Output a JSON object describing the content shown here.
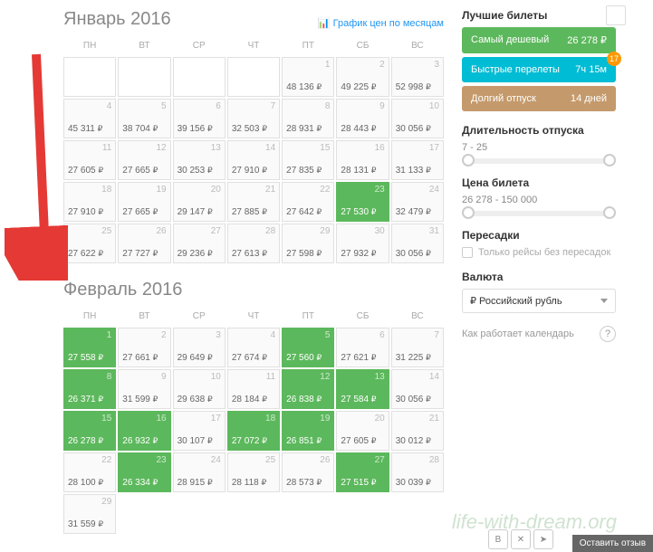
{
  "months": [
    {
      "title": "Январь 2016",
      "chart_link": "График цен по месяцам",
      "weekdays": [
        "ПН",
        "ВТ",
        "СР",
        "ЧТ",
        "ПТ",
        "СБ",
        "ВС"
      ],
      "offset": 4,
      "days": [
        {
          "n": 1,
          "p": "48 136",
          "g": false
        },
        {
          "n": 2,
          "p": "49 225",
          "g": false
        },
        {
          "n": 3,
          "p": "52 998",
          "g": false
        },
        {
          "n": 4,
          "p": "45 311",
          "g": false
        },
        {
          "n": 5,
          "p": "38 704",
          "g": false
        },
        {
          "n": 6,
          "p": "39 156",
          "g": false
        },
        {
          "n": 7,
          "p": "32 503",
          "g": false
        },
        {
          "n": 8,
          "p": "28 931",
          "g": false
        },
        {
          "n": 9,
          "p": "28 443",
          "g": false
        },
        {
          "n": 10,
          "p": "30 056",
          "g": false
        },
        {
          "n": 11,
          "p": "27 605",
          "g": false
        },
        {
          "n": 12,
          "p": "27 665",
          "g": false
        },
        {
          "n": 13,
          "p": "30 253",
          "g": false
        },
        {
          "n": 14,
          "p": "27 910",
          "g": false
        },
        {
          "n": 15,
          "p": "27 835",
          "g": false
        },
        {
          "n": 16,
          "p": "28 131",
          "g": false
        },
        {
          "n": 17,
          "p": "31 133",
          "g": false
        },
        {
          "n": 18,
          "p": "27 910",
          "g": false
        },
        {
          "n": 19,
          "p": "27 665",
          "g": false
        },
        {
          "n": 20,
          "p": "29 147",
          "g": false
        },
        {
          "n": 21,
          "p": "27 885",
          "g": false
        },
        {
          "n": 22,
          "p": "27 642",
          "g": false
        },
        {
          "n": 23,
          "p": "27 530",
          "g": true
        },
        {
          "n": 24,
          "p": "32 479",
          "g": false
        },
        {
          "n": 25,
          "p": "27 622",
          "g": false
        },
        {
          "n": 26,
          "p": "27 727",
          "g": false
        },
        {
          "n": 27,
          "p": "29 236",
          "g": false
        },
        {
          "n": 28,
          "p": "27 613",
          "g": false
        },
        {
          "n": 29,
          "p": "27 598",
          "g": false
        },
        {
          "n": 30,
          "p": "27 932",
          "g": false
        },
        {
          "n": 31,
          "p": "30 056",
          "g": false
        }
      ]
    },
    {
      "title": "Февраль 2016",
      "weekdays": [
        "ПН",
        "ВТ",
        "СР",
        "ЧТ",
        "ПТ",
        "СБ",
        "ВС"
      ],
      "offset": 0,
      "days": [
        {
          "n": 1,
          "p": "27 558",
          "g": true
        },
        {
          "n": 2,
          "p": "27 661",
          "g": false
        },
        {
          "n": 3,
          "p": "29 649",
          "g": false
        },
        {
          "n": 4,
          "p": "27 674",
          "g": false
        },
        {
          "n": 5,
          "p": "27 560",
          "g": true
        },
        {
          "n": 6,
          "p": "27 621",
          "g": false
        },
        {
          "n": 7,
          "p": "31 225",
          "g": false
        },
        {
          "n": 8,
          "p": "26 371",
          "g": true
        },
        {
          "n": 9,
          "p": "31 599",
          "g": false
        },
        {
          "n": 10,
          "p": "29 638",
          "g": false
        },
        {
          "n": 11,
          "p": "28 184",
          "g": false
        },
        {
          "n": 12,
          "p": "26 838",
          "g": true
        },
        {
          "n": 13,
          "p": "27 584",
          "g": true
        },
        {
          "n": 14,
          "p": "30 056",
          "g": false
        },
        {
          "n": 15,
          "p": "26 278",
          "g": true
        },
        {
          "n": 16,
          "p": "26 932",
          "g": true
        },
        {
          "n": 17,
          "p": "30 107",
          "g": false
        },
        {
          "n": 18,
          "p": "27 072",
          "g": true
        },
        {
          "n": 19,
          "p": "26 851",
          "g": true
        },
        {
          "n": 20,
          "p": "27 605",
          "g": false
        },
        {
          "n": 21,
          "p": "30 012",
          "g": false
        },
        {
          "n": 22,
          "p": "28 100",
          "g": false
        },
        {
          "n": 23,
          "p": "26 334",
          "g": true
        },
        {
          "n": 24,
          "p": "28 915",
          "g": false
        },
        {
          "n": 25,
          "p": "28 118",
          "g": false
        },
        {
          "n": 26,
          "p": "28 573",
          "g": false
        },
        {
          "n": 27,
          "p": "27 515",
          "g": true
        },
        {
          "n": 28,
          "p": "30 039",
          "g": false
        },
        {
          "n": 29,
          "p": "31 559",
          "g": false
        }
      ]
    }
  ],
  "sidebar": {
    "best_tickets_title": "Лучшие билеты",
    "cheapest": {
      "label": "Самый дешевый",
      "value": "26 278 ₽"
    },
    "fastest": {
      "label": "Быстрые перелеты",
      "value": "7ч 15м",
      "badge": "17"
    },
    "longest": {
      "label": "Долгий отпуск",
      "value": "14 дней"
    },
    "duration_title": "Длительность отпуска",
    "duration_range": "7 - 25",
    "price_title": "Цена билета",
    "price_range": "26 278 - 150 000",
    "transfers_title": "Пересадки",
    "direct_only": "Только рейсы без пересадок",
    "currency_title": "Валюта",
    "currency_value": "₽ Российский рубль",
    "help_text": "Как работает календарь"
  },
  "footer": {
    "feedback": "Оставить отзыв",
    "watermark": "life-with-dream.org"
  }
}
